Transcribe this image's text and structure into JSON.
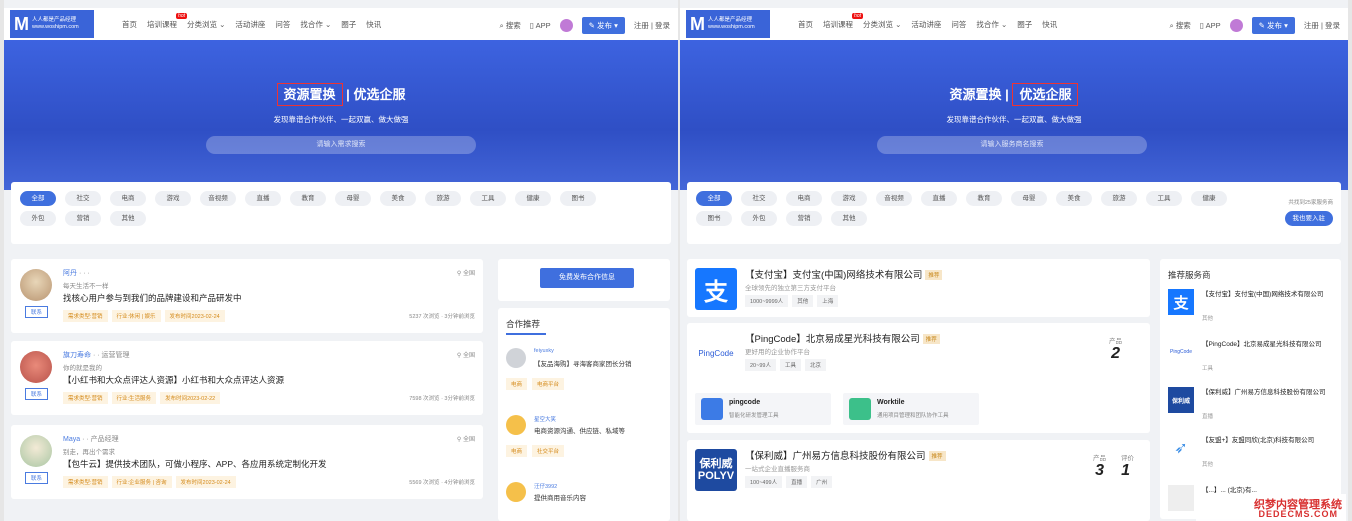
{
  "site": {
    "logo_mark": "M",
    "logo_text": "人人都是产品经理",
    "logo_url": "www.woshipm.com"
  },
  "nav": {
    "links": [
      "首页",
      "培训课程",
      "分类浏览 ⌄",
      "活动讲座",
      "问答",
      "找合作 ⌄",
      "圈子",
      "快讯"
    ],
    "hot": "hot",
    "search": "搜索",
    "app": "APP",
    "publish": "发布 ▾",
    "login": "注册 | 登录"
  },
  "left": {
    "banner": {
      "title_boxed": "资源置换",
      "sep": "|",
      "title_plain": "优选企服",
      "subtitle": "发现靠谱合作伙伴、一起双赢、做大做强",
      "search_placeholder": "请输入需求搜索"
    },
    "categories": [
      "全部",
      "社交",
      "电商",
      "游戏",
      "音视频",
      "直播",
      "教育",
      "母婴",
      "美食",
      "旅游",
      "工具",
      "健康",
      "图书",
      "外包",
      "营销",
      "其他"
    ],
    "demands": [
      {
        "name": "阿丹",
        "role": "· · ·",
        "sign": "每天生活不一样",
        "title": "找核心用户参与到我们的品牌建设和产品研发中",
        "contact": "联系",
        "location": "全国",
        "tags": [
          "需求类型:营销",
          "行业:休闲 | 娱乐",
          "发布时间2023-02-24"
        ],
        "stats": "5237 次浏览 · 3分钟前浏览"
      },
      {
        "name": "旗刀寿命",
        "role": "· · 运营管理",
        "sign": "你的就是我的",
        "title": "【小红书和大众点评达人资源】小红书和大众点评达人资源",
        "contact": "联系",
        "location": "全国",
        "tags": [
          "需求类型:营销",
          "行业:生活服务",
          "发布时间2023-02-22"
        ],
        "stats": "7598 次浏览 · 3分钟前浏览"
      },
      {
        "name": "Maya",
        "role": "· · 产品经理",
        "sign": "别走，再出个需求",
        "title": "【包牛云】提供技术团队，可做小程序、APP、各应用系统定制化开发",
        "contact": "联系",
        "location": "全国",
        "tags": [
          "需求类型:营销",
          "行业:企业服务 | 咨询",
          "发布时间2023-02-24"
        ],
        "stats": "5569 次浏览 · 4分钟前浏览"
      }
    ],
    "free_publish": "免费发布合作信息",
    "recommend_title": "合作推荐",
    "recommends": [
      {
        "name": "feiyuxky",
        "desc": "【友品海购】寻海客商家团长分销",
        "tags": [
          "电商",
          "电商平台"
        ]
      },
      {
        "name": "星空大笑",
        "desc": "电商资源沟通、供应链、私域等",
        "tags": [
          "电商",
          "社交平台"
        ]
      },
      {
        "name": "汪仔3992",
        "desc": "提供商用音乐内容",
        "tags": []
      }
    ]
  },
  "right": {
    "banner": {
      "title_plain": "资源置换",
      "sep": "|",
      "title_boxed": "优选企服",
      "subtitle": "发现靠谱合作伙伴、一起双赢、做大做强",
      "search_placeholder": "请输入服务商名搜索"
    },
    "categories": [
      "全部",
      "社交",
      "电商",
      "游戏",
      "音视频",
      "直播",
      "教育",
      "母婴",
      "美食",
      "旅游",
      "工具",
      "健康",
      "图书",
      "外包",
      "营销",
      "其他"
    ],
    "sort_note": "共找到25家服务商",
    "join_btn": "我也要入驻",
    "companies": [
      {
        "logo": "支",
        "logo_color": "#1677ff",
        "name": "【支付宝】支付宝(中国)网络技术有限公司",
        "rec": "推荐",
        "desc": "全球领先的独立第三方支付平台",
        "tags": [
          "1000~9999人",
          "其他",
          "上海"
        ]
      },
      {
        "logo": "PingCode",
        "logo_color": "#ffffff",
        "name": "【PingCode】北京易成星光科技有限公司",
        "rec": "推荐",
        "desc": "更好用的企业协作平台",
        "tags": [
          "20~99人",
          "工具",
          "北京"
        ],
        "product_label": "产品",
        "product_num": "2",
        "products": [
          {
            "name": "pingcode",
            "desc": "智能化研发管理工具",
            "color": "#3c7be6"
          },
          {
            "name": "Worktile",
            "desc": "通用项目管理和团队协作工具",
            "color": "#3cc08a"
          }
        ]
      },
      {
        "logo": "保利威\nPOLYV",
        "logo_color": "#1e4aa0",
        "name": "【保利威】广州易方信息科技股份有限公司",
        "rec": "推荐",
        "desc": "一站式企业直播服务商",
        "tags": [
          "100~499人",
          "直播",
          "广州"
        ],
        "product_label": "产品",
        "product_num": "3",
        "review_label": "评价",
        "review_num": "1"
      }
    ],
    "service_title": "推荐服务商",
    "services": [
      {
        "logo": "支",
        "color": "#1677ff",
        "name": "【支付宝】支付宝(中国)网络技术有限公司",
        "tag": "其他"
      },
      {
        "logo": "PingCode",
        "color": "#ffffff",
        "name": "【PingCode】北京易成星光科技有限公司",
        "tag": "工具"
      },
      {
        "logo": "保利威",
        "color": "#1e4aa0",
        "name": "【保利威】广州易方信息科技股份有限公司",
        "tag": "直播"
      },
      {
        "logo": "➶",
        "color": "#ffffff",
        "name": "【友盟+】友盟同欣(北京)科技有限公司",
        "tag": "其他"
      },
      {
        "logo": "",
        "color": "#ffffff",
        "name": "【...】... (北京)有...",
        "tag": ""
      }
    ]
  },
  "watermark": {
    "line1": "织梦内容管理系统",
    "line2": "DEDECMS.COM"
  }
}
